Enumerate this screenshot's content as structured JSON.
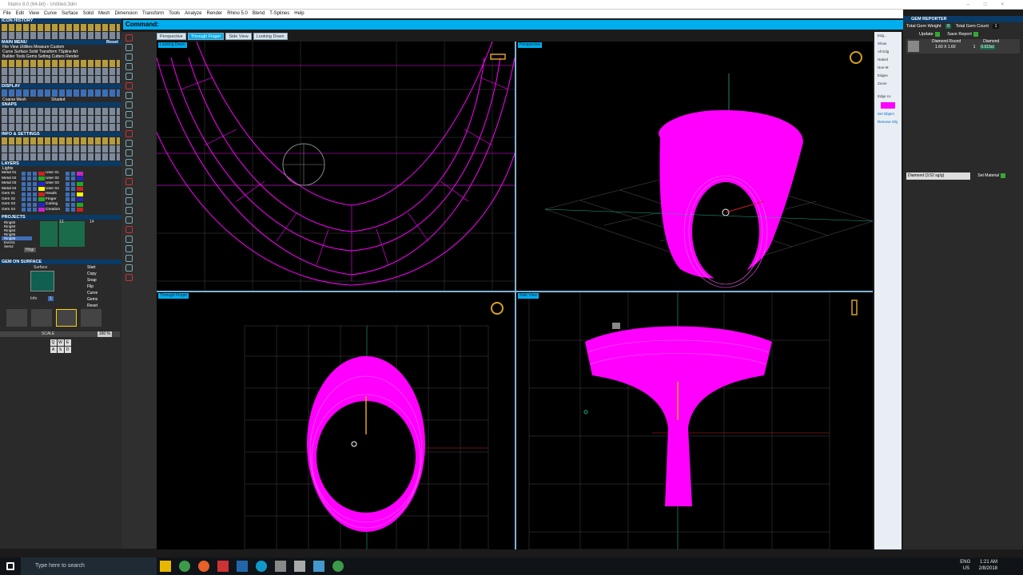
{
  "title": "Matrix 8.0 (64-bit) - Untitled.3dm",
  "menu": [
    "File",
    "Edit",
    "View",
    "Curve",
    "Surface",
    "Solid",
    "Mesh",
    "Dimension",
    "Transform",
    "Tools",
    "Analyze",
    "Render",
    "Rhino 5.0",
    "Blend",
    "T-Splines",
    "Help"
  ],
  "command": {
    "label": "Command:"
  },
  "left": {
    "icon_history": "ICON HISTORY",
    "main_menu": "MAIN MENU",
    "main_menu_reset": "Reset",
    "main_menu_items": "File  View  Utilities  Measure  Custom",
    "main_menu_row2": "Curve  Surface  Solid  Transform  TSpline  Art",
    "main_menu_row3": "Builder  Tools  Gems  Setting  Cutters  Render",
    "display": "DISPLAY",
    "display_mode1": "Coarse Mesh",
    "display_mode2": "Shaded",
    "snaps": "SNAPS",
    "info_settings": "INFO & SETTINGS",
    "layers_title": "LAYERS",
    "layers_lights": "Lights",
    "layers_left": [
      "Metal 01",
      "Metal 02",
      "Metal 03",
      "Metal 04",
      "Gem 01",
      "Gem 02",
      "Gem 03",
      "Gem 04"
    ],
    "layers_right": [
      "User 01",
      "User 02",
      "User 03",
      "User 04",
      "Heads",
      "Finger",
      "Cutting",
      "Creation"
    ],
    "projects": "PROJECTS",
    "project_list": [
      "Ring92",
      "Ring93",
      "Ring94",
      "Ring95",
      "Ring96",
      "Evers1",
      "Sers2"
    ],
    "project_nums": [
      "13",
      "14"
    ],
    "project_btn": "Hngr",
    "gem_on_surface": "GEM ON SURFACE",
    "surface": "Surface",
    "info": "Info",
    "info_val": "1",
    "gos_buttons": [
      "Start",
      "Copy",
      "Snap",
      "Flip",
      "Curve",
      "Gems",
      "Reset"
    ],
    "scale": "SCALE",
    "scale_val": "160 %",
    "keys": [
      "Q",
      "W",
      "E",
      "A",
      "S",
      "D"
    ]
  },
  "viewports": {
    "tabs": [
      "Perspective",
      "Through Finger",
      "Side View",
      "Looking Down"
    ],
    "tl": "Looking Down",
    "tr": "Perspective",
    "bl": "Through Finger",
    "br": "Side View"
  },
  "right_strip": {
    "items": [
      "Edg...",
      "Show",
      "All Edg",
      "Naked",
      "Non-M",
      "Edges",
      "Zoom",
      "Edge co",
      "Sel Object",
      "Remove Obj"
    ]
  },
  "gem_reporter": {
    "title": "GEM REPORTER",
    "total_weight_label": "Total Gem Weight",
    "total_weight_value": "0",
    "total_count_label": "Total Gem Count",
    "total_count_value": "1",
    "update": "Update",
    "save_report": "Save Report",
    "table_header": [
      "Diamond Round",
      "Diamond"
    ],
    "table_row": [
      "1.60 X 1.60",
      "1",
      "0.015ct"
    ],
    "material": "Diamond  (3.52 sg/g)",
    "set_material": "Set Material"
  },
  "taskbar": {
    "search": "Type here to search",
    "lang": "ENG",
    "locale": "US",
    "time": "1:21 AM",
    "date": "2/8/2018"
  },
  "colors": {
    "accent": "#00aeef",
    "wire": "#ff00ff",
    "grid": "#555555"
  }
}
